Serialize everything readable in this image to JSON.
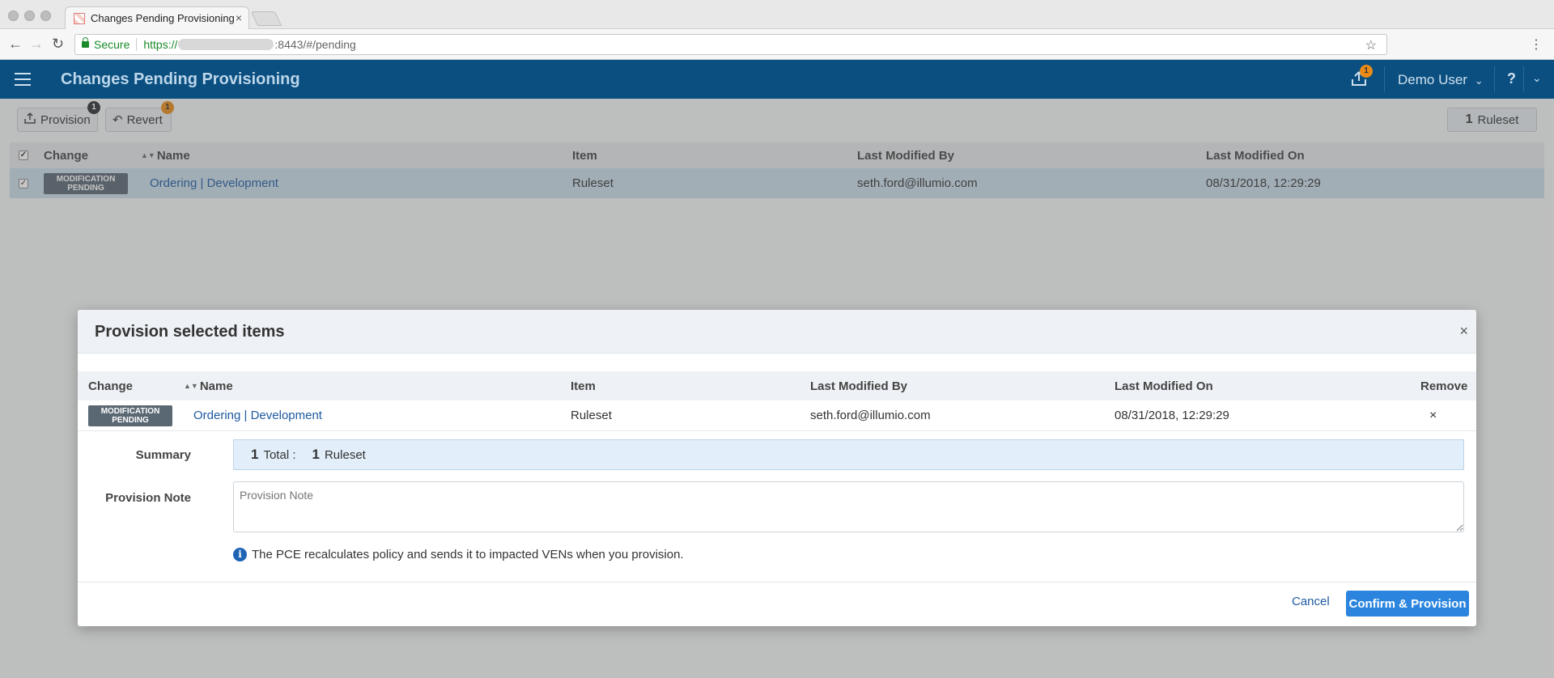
{
  "browser": {
    "tab_title": "Changes Pending Provisioning",
    "tab_close": "×",
    "secure_label": "Secure",
    "url_scheme": "https://",
    "url_rest": ":8443/#/pending"
  },
  "header": {
    "title": "Changes Pending Provisioning",
    "provision_badge": "1",
    "user_name": "Demo User",
    "help": "?"
  },
  "toolbar": {
    "provision_label": "Provision",
    "provision_count": "1",
    "revert_label": "Revert",
    "revert_count": "1",
    "ruleset_count": "1",
    "ruleset_label": "Ruleset"
  },
  "table": {
    "columns": [
      "Change",
      "Name",
      "Item",
      "Last Modified By",
      "Last Modified On"
    ],
    "rows": [
      {
        "change": "MODIFICATION PENDING",
        "name": "Ordering | Development",
        "item": "Ruleset",
        "modified_by": "seth.ford@illumio.com",
        "modified_on": "08/31/2018, 12:29:29"
      }
    ]
  },
  "modal": {
    "title": "Provision selected items",
    "close": "×",
    "columns": [
      "Change",
      "Name",
      "Item",
      "Last Modified By",
      "Last Modified On",
      "Remove"
    ],
    "rows": [
      {
        "change": "MODIFICATION PENDING",
        "name": "Ordering | Development",
        "item": "Ruleset",
        "modified_by": "seth.ford@illumio.com",
        "modified_on": "08/31/2018, 12:29:29",
        "remove": "×"
      }
    ],
    "summary_label": "Summary",
    "summary_total_count": "1",
    "summary_total_label": "Total :",
    "summary_ruleset_count": "1",
    "summary_ruleset_label": "Ruleset",
    "note_label": "Provision Note",
    "note_placeholder": "Provision Note",
    "info_text": "The PCE recalculates policy and sends it to impacted VENs when you provision.",
    "cancel_label": "Cancel",
    "confirm_label": "Confirm & Provision"
  },
  "colors": {
    "header_bg": "#0a4f80",
    "accent_blue": "#2b85df",
    "link": "#1e5aa0",
    "badge_orange": "#e98a16"
  }
}
